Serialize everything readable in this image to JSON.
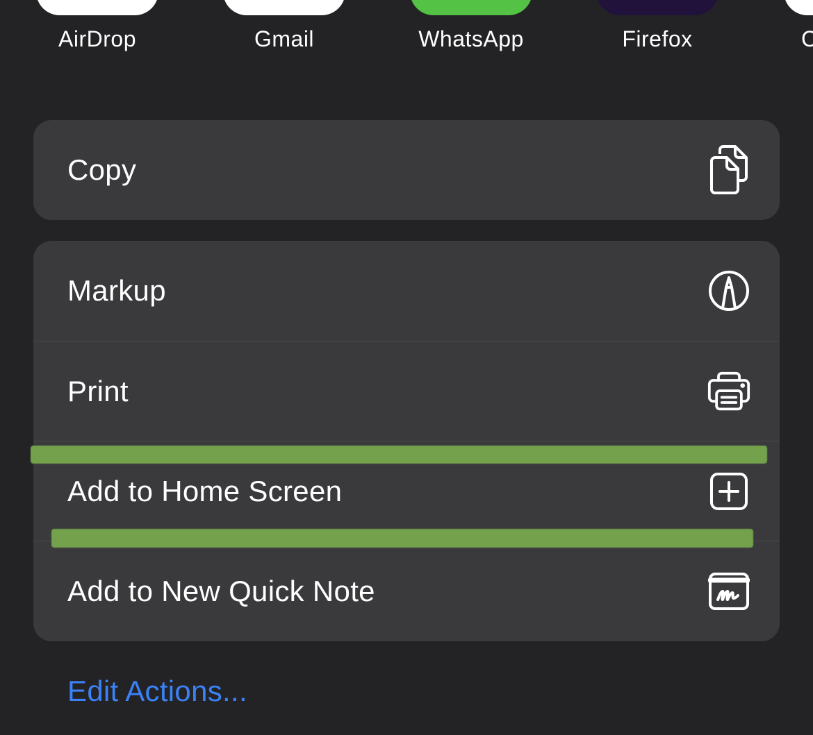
{
  "share_sheet": {
    "apps": [
      {
        "label": "AirDrop",
        "icon": "airdrop-icon"
      },
      {
        "label": "Gmail",
        "icon": "gmail-icon"
      },
      {
        "label": "WhatsApp",
        "icon": "whatsapp-icon"
      },
      {
        "label": "Firefox",
        "icon": "firefox-icon"
      },
      {
        "label": "C",
        "icon": "app-icon"
      }
    ],
    "copy_group": {
      "copy_label": "Copy",
      "copy_icon": "copy-icon"
    },
    "actions_group": [
      {
        "label": "Markup",
        "icon": "markup-pen-icon"
      },
      {
        "label": "Print",
        "icon": "printer-icon"
      },
      {
        "label": "Add to Home Screen",
        "icon": "plus-square-icon"
      },
      {
        "label": "Add to New Quick Note",
        "icon": "quick-note-icon"
      }
    ],
    "edit_actions_label": "Edit Actions..."
  },
  "colors": {
    "background": "#232325",
    "group_background": "#3a3a3c",
    "accent_link": "#3b82f6",
    "highlight_green": "#74a14c",
    "whatsapp_green": "#54c244"
  }
}
